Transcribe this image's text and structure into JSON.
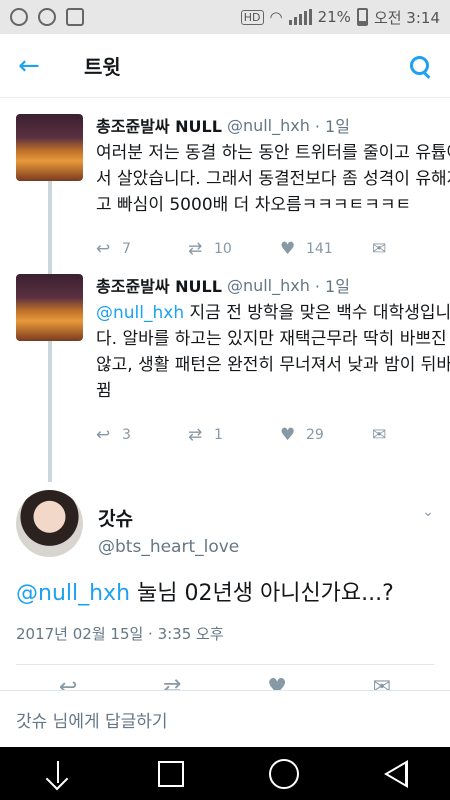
{
  "status_bar": {
    "battery": "21%",
    "time": "오전 3:14",
    "hd_label": "HD",
    "icons": [
      "app-icon",
      "settings-icon",
      "image-icon",
      "hd-icon",
      "wifi-icon",
      "signal-icon",
      "battery-icon"
    ]
  },
  "app_bar": {
    "title": "트윗",
    "back_icon": "arrow-left-icon",
    "search_icon": "search-icon",
    "accent_color": "#1da1f2"
  },
  "thread": [
    {
      "name": "총조쥰발싸 NULL",
      "handle": "@null_hxh",
      "age": "· 1일",
      "mention": "",
      "text": "여러분 저는 동결 하는 동안 트위터를 줄이고 유튭에서 살았습니다. 그래서 동결전보다 좀 성격이 유해지고 빠심이 5000배 더 차오름ㅋㅋㅋㅌㅋㅋㅌ",
      "replies": "7",
      "retweets": "10",
      "likes": "141"
    },
    {
      "name": "총조쥰발싸 NULL",
      "handle": "@null_hxh",
      "age": "· 1일",
      "mention": "@null_hxh",
      "text": " 지금 전 방학을 맞은 백수 대학생입니다. 알바를 하고는 있지만 재택근무라 딱히 바쁘진 않고, 생활 패턴은 완전히 무너져서 낮과 밤이 뒤바뀜",
      "replies": "3",
      "retweets": "1",
      "likes": "29"
    }
  ],
  "main_tweet": {
    "name": "갓슈",
    "handle": "@bts_heart_love",
    "mention": "@null_hxh",
    "text": " 눌님 02년생 아니신가요...?",
    "timestamp": "2017년 02월 15일 · 3:35 오후"
  },
  "reply_bar": {
    "placeholder": "갓슈 님에게 답글하기"
  },
  "nav_bar": {
    "icons": [
      "hide-keyboard-icon",
      "recents-icon",
      "home-icon",
      "back-icon"
    ]
  }
}
